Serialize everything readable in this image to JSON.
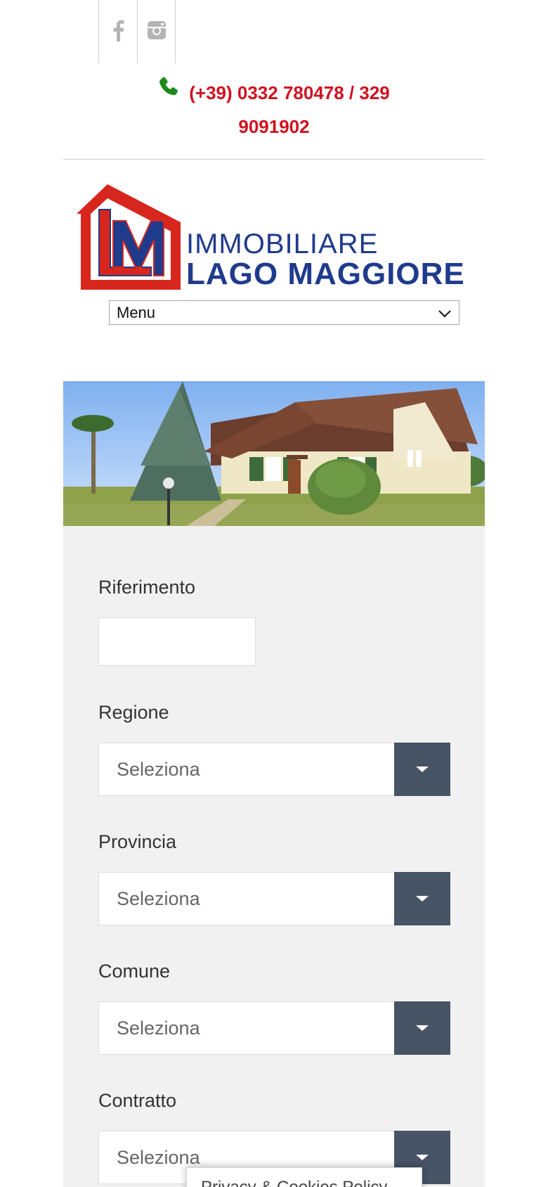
{
  "social": {
    "items": [
      {
        "name": "facebook",
        "icon": "facebook-icon"
      },
      {
        "name": "instagram",
        "icon": "instagram-icon"
      }
    ]
  },
  "header": {
    "phone_line1": "(+39) 0332 780478 / 329",
    "phone_line2": "9091902",
    "phone_color": "#d1101f",
    "phone_icon_color": "#1b8a1b"
  },
  "logo": {
    "line1": "IMMOBILIARE",
    "line2": "LAGO MAGGIORE",
    "red": "#d7261e",
    "navy": "#1f3b8c"
  },
  "nav": {
    "menu_label": "Menu"
  },
  "search": {
    "riferimento_label": "Riferimento",
    "riferimento_value": "",
    "regione_label": "Regione",
    "regione_value": "Seleziona",
    "provincia_label": "Provincia",
    "provincia_value": "Seleziona",
    "comune_label": "Comune",
    "comune_value": "Seleziona",
    "contratto_label": "Contratto",
    "contratto_value": "Seleziona",
    "button_color": "#475466"
  },
  "cookie": {
    "text": "Privacy & Cookies Policy"
  }
}
